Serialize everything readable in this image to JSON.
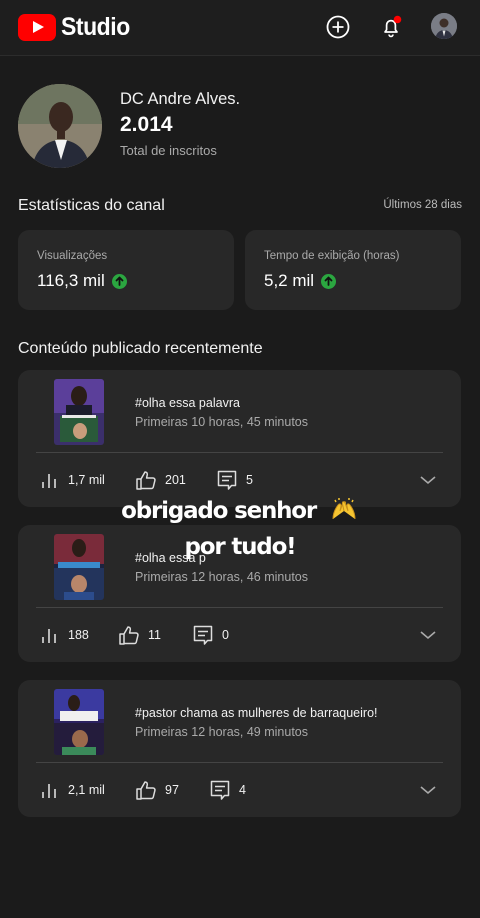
{
  "app": {
    "logo_text": "Studio"
  },
  "topbar": {
    "icons": [
      "create-icon",
      "notifications-icon",
      "account-avatar"
    ],
    "notification_dot_color": "#ff0000"
  },
  "channel": {
    "name": "DC Andre Alves.",
    "subscribers": "2.014",
    "subscribers_label": "Total de inscritos"
  },
  "stats": {
    "title": "Estatísticas do canal",
    "period": "Últimos 28 dias",
    "views": {
      "label": "Visualizações",
      "value": "116,3 mil"
    },
    "watch_time": {
      "label": "Tempo de exibição (horas)",
      "value": "5,2 mil"
    },
    "trend_color": "#2ba640"
  },
  "recent": {
    "title": "Conteúdo publicado recentemente",
    "videos": [
      {
        "title": "#olha essa palavra",
        "meta": "Primeiras 10 horas, 45 minutos",
        "views": "1,7 mil",
        "likes": "201",
        "comments": "5"
      },
      {
        "title": "#olha essa p",
        "meta": "Primeiras 12 horas, 46 minutos",
        "views": "188",
        "likes": "11",
        "comments": "0"
      },
      {
        "title": "#pastor chama as mulheres de barraqueiro!",
        "meta": "Primeiras 12 horas, 49 minutos",
        "views": "2,1 mil",
        "likes": "97",
        "comments": "4"
      }
    ]
  },
  "overlay": {
    "line1": "obrigado senhor",
    "line2": "por tudo!",
    "emoji": "raising-hands-icon",
    "outline_color": "#8b5cf6"
  }
}
